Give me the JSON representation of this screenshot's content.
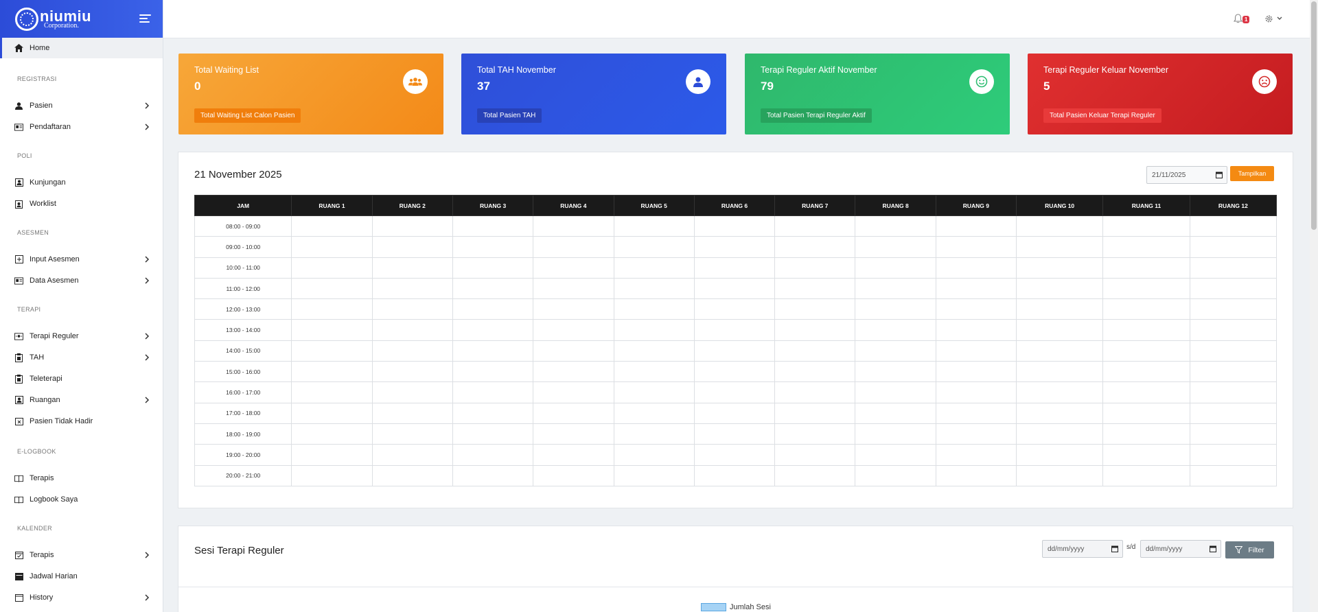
{
  "brand": {
    "name": "niumiu",
    "sub": "Corporation."
  },
  "sidebar": {
    "home": "Home",
    "sections": {
      "registrasi": "REGISTRASI",
      "poli": "POLI",
      "asesmen": "ASESMEN",
      "terapi": "TERAPI",
      "elogbook": "E-LOGBOOK",
      "kalender": "KALENDER"
    },
    "items": {
      "pasien": "Pasien",
      "pendaftaran": "Pendaftaran",
      "kunjungan": "Kunjungan",
      "worklist": "Worklist",
      "input_asesmen": "Input Asesmen",
      "data_asesmen": "Data Asesmen",
      "terapi_reguler": "Terapi Reguler",
      "tah": "TAH",
      "teleterapi": "Teleterapi",
      "ruangan": "Ruangan",
      "pasien_tidak_hadir": "Pasien Tidak Hadir",
      "terapis_logbook": "Terapis",
      "logbook_saya": "Logbook Saya",
      "terapis_kalender": "Terapis",
      "jadwal_harian": "Jadwal Harian",
      "history": "History"
    }
  },
  "topbar": {
    "notif_count": "1"
  },
  "cards": [
    {
      "title": "Total Waiting List",
      "value": "0",
      "badge": "Total Waiting List Calon Pasien",
      "icon": "users-icon"
    },
    {
      "title": "Total TAH November",
      "value": "37",
      "badge": "Total Pasien TAH",
      "icon": "user-icon"
    },
    {
      "title": "Terapi Reguler Aktif November",
      "value": "79",
      "badge": "Total Pasien Terapi Reguler Aktif",
      "icon": "smile-icon"
    },
    {
      "title": "Terapi Reguler Keluar November",
      "value": "5",
      "badge": "Total Pasien Keluar Terapi Reguler",
      "icon": "frown-icon"
    }
  ],
  "schedule": {
    "title": "21 November 2025",
    "date_value": "21/11/2025",
    "button": "Tampilkan",
    "columns": [
      "JAM",
      "RUANG 1",
      "RUANG 2",
      "RUANG 3",
      "RUANG 4",
      "RUANG 5",
      "RUANG 6",
      "RUANG 7",
      "RUANG 8",
      "RUANG 9",
      "RUANG 10",
      "RUANG 11",
      "RUANG 12"
    ],
    "rows": [
      "08:00 - 09:00",
      "09:00 - 10:00",
      "10:00 - 11:00",
      "11:00 - 12:00",
      "12:00 - 13:00",
      "13:00 - 14:00",
      "14:00 - 15:00",
      "15:00 - 16:00",
      "16:00 - 17:00",
      "17:00 - 18:00",
      "18:00 - 19:00",
      "19:00 - 20:00",
      "20:00 - 21:00"
    ]
  },
  "sesi": {
    "title": "Sesi Terapi Reguler",
    "from_placeholder": "dd/mm/yyyy",
    "to_placeholder": "dd/mm/yyyy",
    "separator": "s/d",
    "filter": "Filter",
    "legend": "Jumlah Sesi"
  }
}
